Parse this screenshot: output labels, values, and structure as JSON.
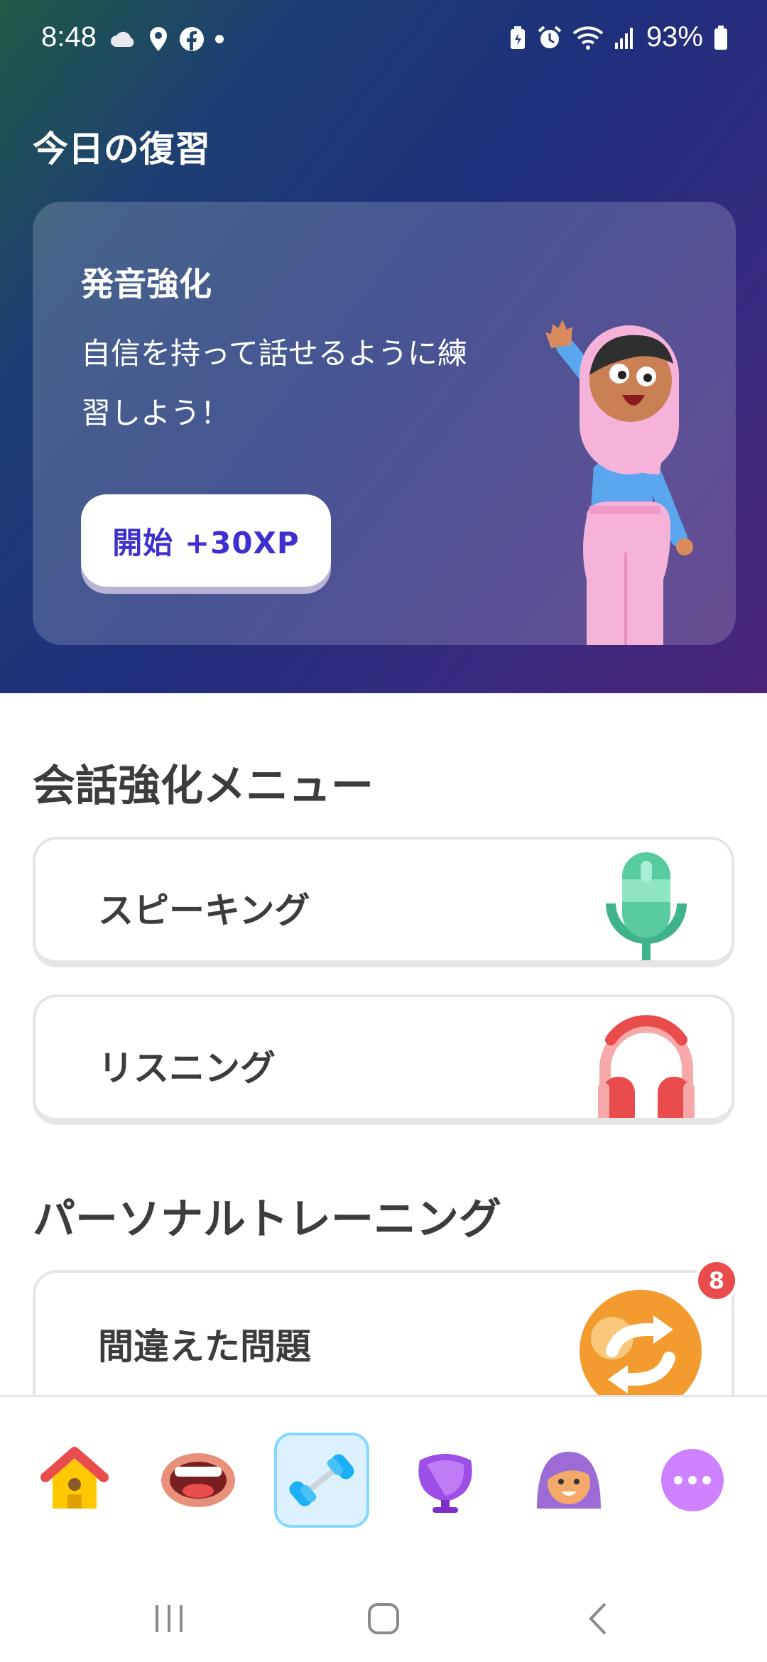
{
  "status_bar": {
    "time": "8:48",
    "left_icons": [
      "cloud-icon",
      "location-pin-icon",
      "facebook-icon",
      "notification-dot-icon"
    ],
    "right_icons": [
      "battery-saver-icon",
      "alarm-icon",
      "wifi-icon",
      "signal-icon"
    ],
    "battery": "93%"
  },
  "hero": {
    "title": "今日の復習",
    "card": {
      "title": "発音強化",
      "description": "自信を持って話せるように練習しよう！",
      "button": "開始 +30XP"
    }
  },
  "conversation_section": {
    "title": "会話強化メニュー",
    "items": [
      {
        "label": "スピーキング",
        "icon": "microphone-icon"
      },
      {
        "label": "リスニング",
        "icon": "headphones-icon"
      }
    ]
  },
  "personal_section": {
    "title": "パーソナルトレーニング",
    "items": [
      {
        "label": "間違えた問題",
        "icon": "refresh-arrows-icon",
        "badge": "8"
      }
    ]
  },
  "tab_bar": {
    "items": [
      {
        "icon": "home-icon",
        "active": false
      },
      {
        "icon": "mouth-icon",
        "active": false
      },
      {
        "icon": "dumbbell-icon",
        "active": true
      },
      {
        "icon": "shield-icon",
        "active": false
      },
      {
        "icon": "profile-icon",
        "active": false
      },
      {
        "icon": "more-icon",
        "active": false
      }
    ]
  },
  "colors": {
    "accent": "#3f2fd0",
    "active_tab": "#84d8ff",
    "badge": "#ea4b4b"
  }
}
